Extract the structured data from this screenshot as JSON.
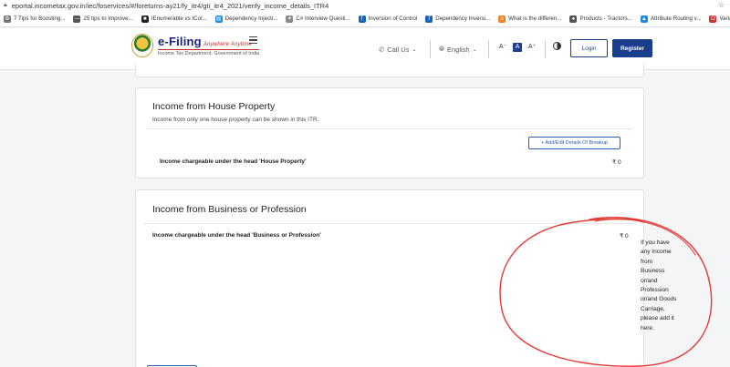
{
  "browser": {
    "url": "eportal.incometax.gov.in/iec/foservices/#/foreturns-ay21/fy_itr4/gti_itr4_2021/verify_income_details_ITR4",
    "bookmarks": [
      {
        "label": "7 Tips for Boosting...",
        "icon": "gear-icon",
        "color": "#777777"
      },
      {
        "label": "25 tips to Improve...",
        "icon": "dash-icon",
        "color": "#555555"
      },
      {
        "label": "IEnumerable vs ICol...",
        "icon": "dotnet-icon",
        "color": "#222222"
      },
      {
        "label": "Dependency Injecti...",
        "icon": "page-icon",
        "color": "#1e88e5"
      },
      {
        "label": "C# Interview Questi...",
        "icon": "bird-icon",
        "color": "#888888"
      },
      {
        "label": "Inversion of Control",
        "icon": "t-icon",
        "color": "#1565c0"
      },
      {
        "label": "Dependency Inversi...",
        "icon": "t-icon",
        "color": "#1565c0"
      },
      {
        "label": "What is the differen...",
        "icon": "stack-icon",
        "color": "#f48024"
      },
      {
        "label": "Products - Tractors...",
        "icon": "globe-icon",
        "color": "#555555"
      },
      {
        "label": "Attribute Routing v...",
        "icon": "person-icon",
        "color": "#1e88e5"
      },
      {
        "label": "Variable Sc",
        "icon": "o-icon",
        "color": "#d32f2f"
      }
    ]
  },
  "header": {
    "logo_title": "e-Filing",
    "logo_tagline": "Anywhere Anytime",
    "logo_sub": "Income Tax Department, Government of India",
    "call_us": "Call Us",
    "language": "English",
    "font_decrease": "A⁻",
    "font_normal": "A",
    "font_increase": "A⁺",
    "login": "Login",
    "register": "Register",
    "accent_color": "#1a3e8c"
  },
  "house_property": {
    "title": "Income from House Property",
    "description": "Income from only one house property can be shown in this ITR.",
    "add_edit_button": "+ Add/Edit Details Of Breakup",
    "row_label": "Income chargeable under the head 'House Property'",
    "row_value": "₹ 0"
  },
  "business": {
    "title": "Income from Business or Profession",
    "row_label": "Income chargeable under the head 'Business or Profession'",
    "row_value": "₹ 0",
    "side_note": "If you have any Income from Business or/and Profession or/and Goods Carriage, please add it here."
  }
}
